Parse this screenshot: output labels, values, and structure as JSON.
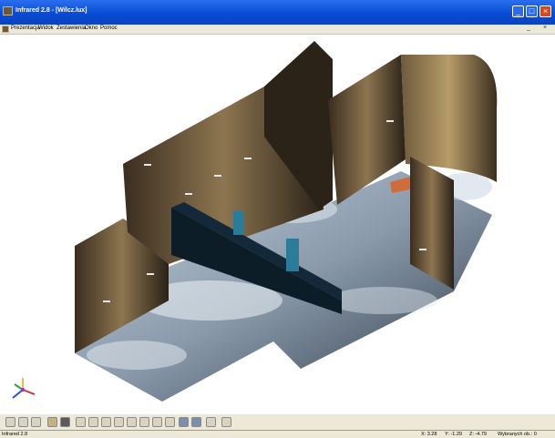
{
  "window": {
    "title": "Infrared 2.8 - [Wilcz.lux]"
  },
  "menu": {
    "items": [
      "Prezentacja",
      "Widok",
      "Zestawienia",
      "Okno",
      "Pomoc"
    ],
    "mdi_buttons": [
      "_",
      "×"
    ]
  },
  "window_buttons": {
    "minimize": "_",
    "maximize": "□",
    "close": "×"
  },
  "viewport": {
    "scene": "3d-room-illuminance-render",
    "colors": {
      "floor_light": "#dfe9f1",
      "floor_dark": "#1b2430",
      "wall_dark": "#2a2218",
      "wall_lit": "#c2a56e",
      "partition": "#0c1d28",
      "pillar": "#2b7c98",
      "table": "#d06b3a"
    }
  },
  "toolbar": {
    "icons": [
      "pencil-icon",
      "save-icon",
      "print-icon",
      "cube-icon",
      "box-view-icon",
      "view-front-icon",
      "view-back-icon",
      "view-left-icon",
      "view-right-icon",
      "view-top-icon",
      "view-bottom-icon",
      "view-iso-icon",
      "view-persp-icon",
      "settings-icon",
      "render-icon",
      "window-icon",
      "export-icon"
    ]
  },
  "status": {
    "app": "Infrared 2.8",
    "x": "X: 3.28",
    "y": "Y: -1.29",
    "z": "Z: -4.79",
    "selected": "Wybranych ob.: 0"
  }
}
